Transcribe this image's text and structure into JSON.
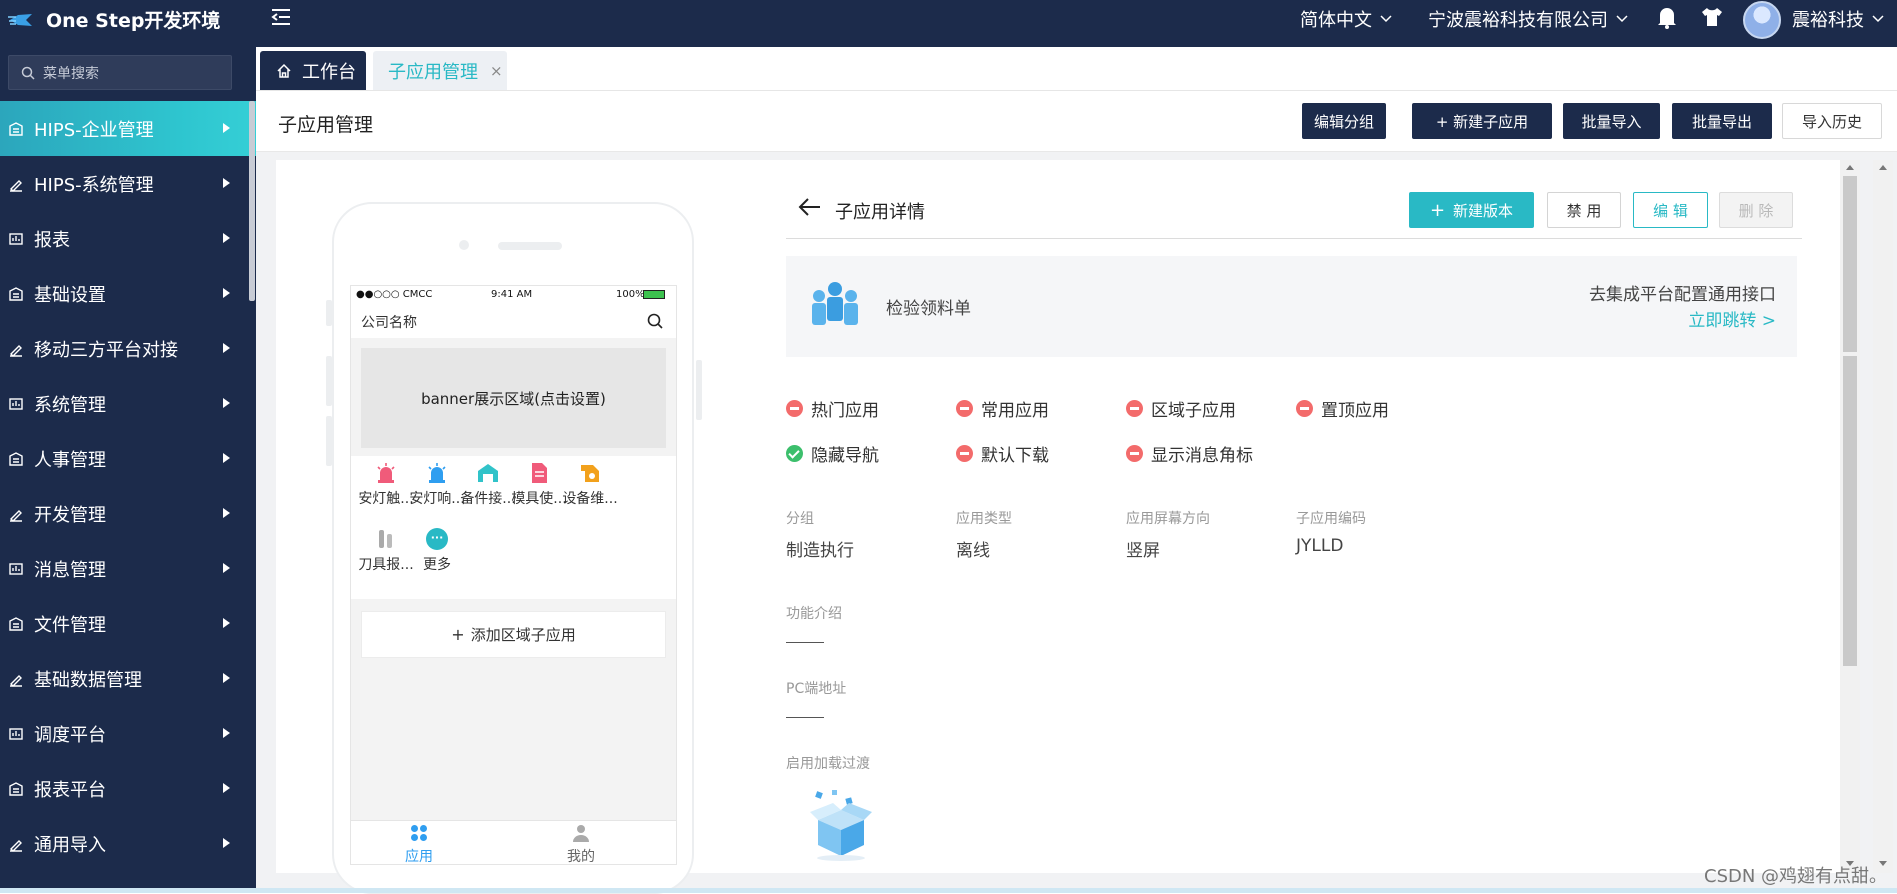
{
  "app": {
    "title": "One Step开发环境",
    "language": "简体中文",
    "company": "宁波震裕科技有限公司",
    "username": "震裕科技",
    "accent_color": "#29b9c5",
    "nav_color": "#1c2b4b"
  },
  "sidebar": {
    "search_placeholder": "菜单搜索",
    "items": [
      {
        "label": "HIPS-企业管理",
        "icon": "building-icon"
      },
      {
        "label": "HIPS-系统管理",
        "icon": "pen-icon"
      },
      {
        "label": "报表",
        "icon": "report-icon"
      },
      {
        "label": "基础设置",
        "icon": "settings-icon"
      },
      {
        "label": "移动三方平台对接",
        "icon": "mobile-icon"
      },
      {
        "label": "系统管理",
        "icon": "monitor-icon"
      },
      {
        "label": "人事管理",
        "icon": "people-icon"
      },
      {
        "label": "开发管理",
        "icon": "code-icon"
      },
      {
        "label": "消息管理",
        "icon": "message-icon"
      },
      {
        "label": "文件管理",
        "icon": "file-icon"
      },
      {
        "label": "基础数据管理",
        "icon": "database-icon"
      },
      {
        "label": "调度平台",
        "icon": "schedule-icon"
      },
      {
        "label": "报表平台",
        "icon": "chart-icon"
      },
      {
        "label": "通用导入",
        "icon": "import-icon"
      }
    ]
  },
  "tabs": {
    "home": "工作台",
    "current": "子应用管理",
    "close": "×"
  },
  "page": {
    "title": "子应用管理",
    "buttons": [
      "编辑分组",
      "+ 新建子应用",
      "批量导入",
      "批量导出",
      "导入历史"
    ]
  },
  "phone": {
    "carrier": "●●○○○ CMCC",
    "time": "9:41 AM",
    "battery": "100%",
    "company_name": "公司名称",
    "banner": "banner展示区域(点击设置)",
    "apps": [
      {
        "label": "安灯触...",
        "color": "#f05b7a"
      },
      {
        "label": "安灯响...",
        "color": "#2f9ef0"
      },
      {
        "label": "备件接...",
        "color": "#31c3c9"
      },
      {
        "label": "模具使...",
        "color": "#f05b7a"
      },
      {
        "label": "设备维...",
        "color": "#f2a11c"
      },
      {
        "label": "刀具报...",
        "color": "#999999"
      },
      {
        "label": "更多",
        "color": "#29b9c5"
      }
    ],
    "more_symbol": "···",
    "add_area": "添加区域子应用",
    "tab_app": "应用",
    "tab_mine": "我的"
  },
  "detail": {
    "title": "子应用详情",
    "buttons": {
      "new_version": "新建版本",
      "disable": "禁 用",
      "edit": "编 辑",
      "delete": "删 除"
    },
    "app_name": "检验领料单",
    "integration_text": "去集成平台配置通用接口",
    "jump_link": "立即跳转 >",
    "flags": [
      {
        "label": "热门应用",
        "state": "off"
      },
      {
        "label": "常用应用",
        "state": "off"
      },
      {
        "label": "区域子应用",
        "state": "off"
      },
      {
        "label": "置顶应用",
        "state": "off"
      },
      {
        "label": "隐藏导航",
        "state": "on"
      },
      {
        "label": "默认下载",
        "state": "off"
      },
      {
        "label": "显示消息角标",
        "state": "off"
      }
    ],
    "meta": [
      {
        "label": "分组",
        "value": "制造执行"
      },
      {
        "label": "应用类型",
        "value": "离线"
      },
      {
        "label": "应用屏幕方向",
        "value": "竖屏"
      },
      {
        "label": "子应用编码",
        "value": "JYLLD"
      }
    ],
    "intro_label": "功能介绍",
    "pc_label": "PC端地址",
    "loading_label": "启用加载过渡"
  },
  "watermark": "CSDN @鸡翅有点甜。"
}
